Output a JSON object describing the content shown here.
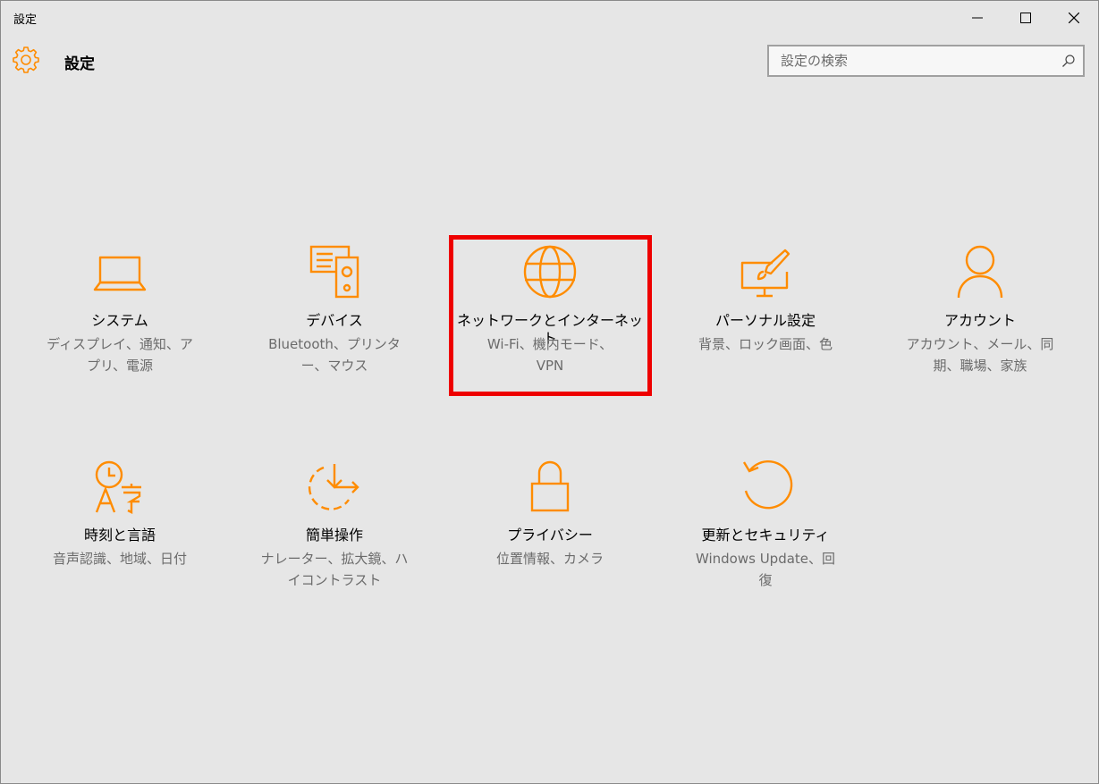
{
  "window": {
    "title": "設定",
    "accent": "#ff8c00",
    "highlight_color": "#ee0000"
  },
  "header": {
    "title": "設定",
    "icon": "gear-icon",
    "search_placeholder": "設定の検索"
  },
  "categories": [
    {
      "id": "system",
      "icon": "laptop-icon",
      "label": "システム",
      "desc": "ディスプレイ、通知、アプリ、電源"
    },
    {
      "id": "devices",
      "icon": "devices-icon",
      "label": "デバイス",
      "desc": "Bluetooth、プリンター、マウス"
    },
    {
      "id": "network",
      "icon": "globe-icon",
      "label": "ネットワークとインターネット",
      "desc": "Wi-Fi、機内モード、VPN",
      "highlighted": true
    },
    {
      "id": "personalization",
      "icon": "paint-monitor-icon",
      "label": "パーソナル設定",
      "desc": "背景、ロック画面、色"
    },
    {
      "id": "accounts",
      "icon": "person-icon",
      "label": "アカウント",
      "desc": "アカウント、メール、同期、職場、家族"
    },
    {
      "id": "time-language",
      "icon": "time-language-icon",
      "label": "時刻と言語",
      "desc": "音声認識、地域、日付"
    },
    {
      "id": "ease-of-access",
      "icon": "ease-of-access-icon",
      "label": "簡単操作",
      "desc": "ナレーター、拡大鏡、ハイコントラスト"
    },
    {
      "id": "privacy",
      "icon": "lock-icon",
      "label": "プライバシー",
      "desc": "位置情報、カメラ"
    },
    {
      "id": "update-security",
      "icon": "refresh-icon",
      "label": "更新とセキュリティ",
      "desc": "Windows Update、回復"
    }
  ]
}
